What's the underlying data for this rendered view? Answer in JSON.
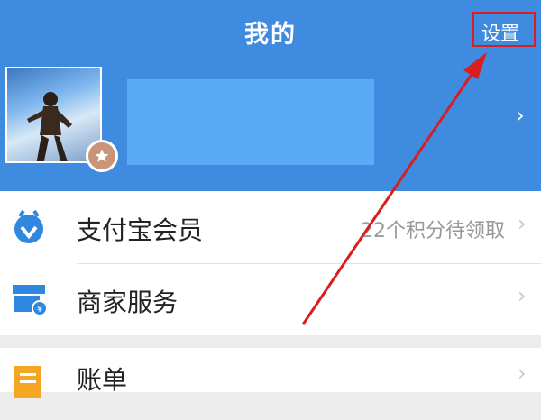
{
  "header": {
    "title": "我的",
    "settings_label": "设置"
  },
  "profile": {
    "avatar": "user-photo",
    "badge_icon": "star-icon"
  },
  "menu": {
    "items": [
      {
        "label": "支付宝会员",
        "value": "22个积分待领取",
        "icon": "member-badge-icon"
      },
      {
        "label": "商家服务",
        "value": "",
        "icon": "shop-icon"
      },
      {
        "label": "账单",
        "value": "",
        "icon": "bill-icon"
      }
    ]
  },
  "colors": {
    "header_bg": "#3f8be0",
    "accent_red": "#d81e1e"
  }
}
